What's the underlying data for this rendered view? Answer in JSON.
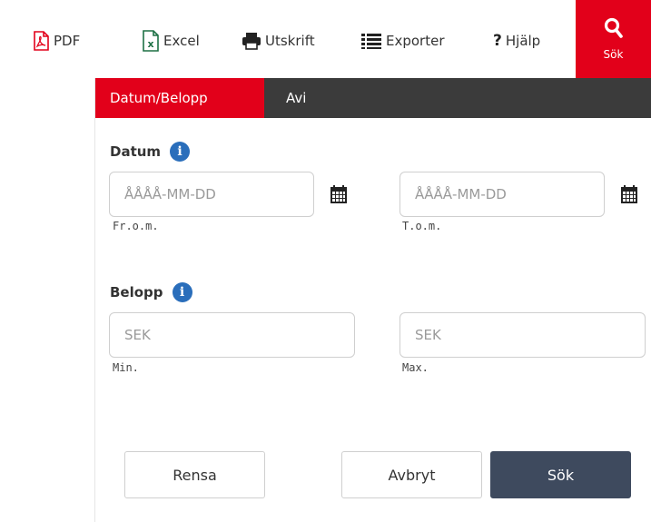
{
  "toolbar": {
    "pdf_label": "PDF",
    "excel_label": "Excel",
    "print_label": "Utskrift",
    "export_label": "Exporter",
    "help_label": "Hjälp",
    "search_label": "Sök"
  },
  "tabs": [
    {
      "label": "Datum/Belopp",
      "active": true
    },
    {
      "label": "Avi",
      "active": false
    }
  ],
  "datum": {
    "label": "Datum",
    "from": {
      "placeholder": "ÅÅÅÅ-MM-DD",
      "value": "",
      "sublabel": "Fr.o.m."
    },
    "to": {
      "placeholder": "ÅÅÅÅ-MM-DD",
      "value": "",
      "sublabel": "T.o.m."
    }
  },
  "belopp": {
    "label": "Belopp",
    "min": {
      "placeholder": "SEK",
      "value": "",
      "sublabel": "Min."
    },
    "max": {
      "placeholder": "SEK",
      "value": "",
      "sublabel": "Max."
    }
  },
  "actions": {
    "clear_label": "Rensa",
    "cancel_label": "Avbryt",
    "search_label": "Sök"
  },
  "colors": {
    "accent": "#e2001a",
    "tabbar": "#3b3b3b",
    "primary_button": "#3e4a5e",
    "info_icon": "#2a6ebb",
    "pdf_icon": "#e2001a",
    "excel_icon": "#1e7145"
  },
  "icons": {
    "pdf": "pdf-icon",
    "excel": "excel-icon",
    "print": "printer-icon",
    "export": "list-icon",
    "help": "question-icon",
    "search": "search-icon",
    "info": "info-icon",
    "calendar": "calendar-icon"
  }
}
